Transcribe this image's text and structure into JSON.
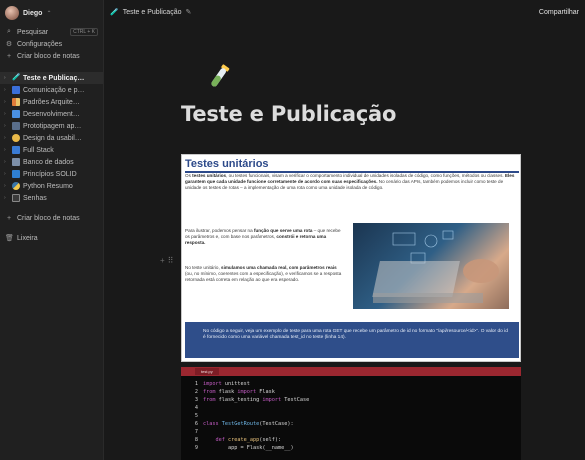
{
  "workspace": {
    "name": "Diego"
  },
  "nav": [
    {
      "label": "Pesquisar",
      "icon": "search-icon",
      "shortcut": "CTRL + K"
    },
    {
      "label": "Configurações",
      "icon": "gear-icon"
    },
    {
      "label": "Criar bloco de notas",
      "icon": "plus-icon"
    }
  ],
  "pages": [
    {
      "label": "Teste e Publicaç…",
      "icon": "test-tube-icon",
      "active": true
    },
    {
      "label": "Comunicação e p…",
      "icon": "chat-icon"
    },
    {
      "label": "Padrões Arquite…",
      "icon": "blocks-icon"
    },
    {
      "label": "Desenvolviment…",
      "icon": "monitor-icon"
    },
    {
      "label": "Prototipagem ap…",
      "icon": "phone-icon"
    },
    {
      "label": "Design da usabil…",
      "icon": "palette-icon"
    },
    {
      "label": "Full Stack",
      "icon": "stack-icon"
    },
    {
      "label": "Banco de dados",
      "icon": "database-icon"
    },
    {
      "label": "Princípios SOLID",
      "icon": "box-icon"
    },
    {
      "label": "Python Resumo",
      "icon": "python-icon"
    },
    {
      "label": "Senhas",
      "icon": "key-icon"
    }
  ],
  "sidebar_bottom": {
    "create": "Criar bloco de notas",
    "trash": "Lixeira"
  },
  "topbar": {
    "title": "Teste e Publicação",
    "share": "Compartilhar"
  },
  "page": {
    "title": "Teste e Publicação"
  },
  "doc": {
    "heading": "Testes unitários",
    "para1_a": "Os ",
    "para1_b": "testes unitários",
    "para1_c": ", ou testes funcionais, visam a verificar o comportamento individual de unidades isoladas de código, como funções, métodos ou classes. ",
    "para1_d": "Eles garantem que cada unidade funcione corretamente de acordo com suas especificações.",
    "para1_e": " No cenário das APIs, também podemos incluir como teste de unidade os testes de rotas – a implementação de uma rota como uma unidade isolada de código.",
    "para2_a": "Para ilustrar, podemos pensar na ",
    "para2_b": "função que serve uma rota",
    "para2_c": " – que recebe os parâmetros e, com base nos parâmetros, ",
    "para2_d": "constrói e retorna uma resposta.",
    "para3_a": "No teste unitário, ",
    "para3_b": "simulamos uma chamada real, com parâmetros reais",
    "para3_c": " (ou, no mínimo, coerentes com a especificação), e verificamos se a resposta retornada está correta em relação ao que era esperado.",
    "note": "No código a seguir, veja um exemplo de teste para uma rota GET que recebe um parâmetro de id no formato \"/api/resource/<id>\". O valor do id é fornecido como uma variável chamada test_id no teste (linha 14)."
  },
  "code": {
    "tab": "test.py",
    "lines": [
      {
        "n": "1",
        "parts": [
          [
            "kw",
            "import"
          ],
          [
            "nm",
            " unittest"
          ]
        ]
      },
      {
        "n": "2",
        "parts": [
          [
            "kw",
            "from"
          ],
          [
            "nm",
            " flask "
          ],
          [
            "kw",
            "import"
          ],
          [
            "nm",
            " Flask"
          ]
        ]
      },
      {
        "n": "3",
        "parts": [
          [
            "kw",
            "from"
          ],
          [
            "nm",
            " flask_testing "
          ],
          [
            "kw",
            "import"
          ],
          [
            "nm",
            " TestCase"
          ]
        ]
      },
      {
        "n": "4",
        "parts": []
      },
      {
        "n": "5",
        "parts": []
      },
      {
        "n": "6",
        "parts": [
          [
            "kw",
            "class"
          ],
          [
            "cls",
            " TestGetRoute"
          ],
          [
            "nm",
            "(TestCase):"
          ]
        ]
      },
      {
        "n": "7",
        "parts": []
      },
      {
        "n": "8",
        "parts": [
          [
            "nm",
            "    "
          ],
          [
            "kw",
            "def"
          ],
          [
            "fn",
            " create_app"
          ],
          [
            "nm",
            "(self):"
          ]
        ]
      },
      {
        "n": "9",
        "parts": [
          [
            "nm",
            "        app = Flask(__name__)"
          ]
        ]
      }
    ]
  },
  "colors": {
    "accent": "#2d4a8a",
    "note_bg": "#2f4e8a",
    "code_bar": "#9b2730"
  }
}
